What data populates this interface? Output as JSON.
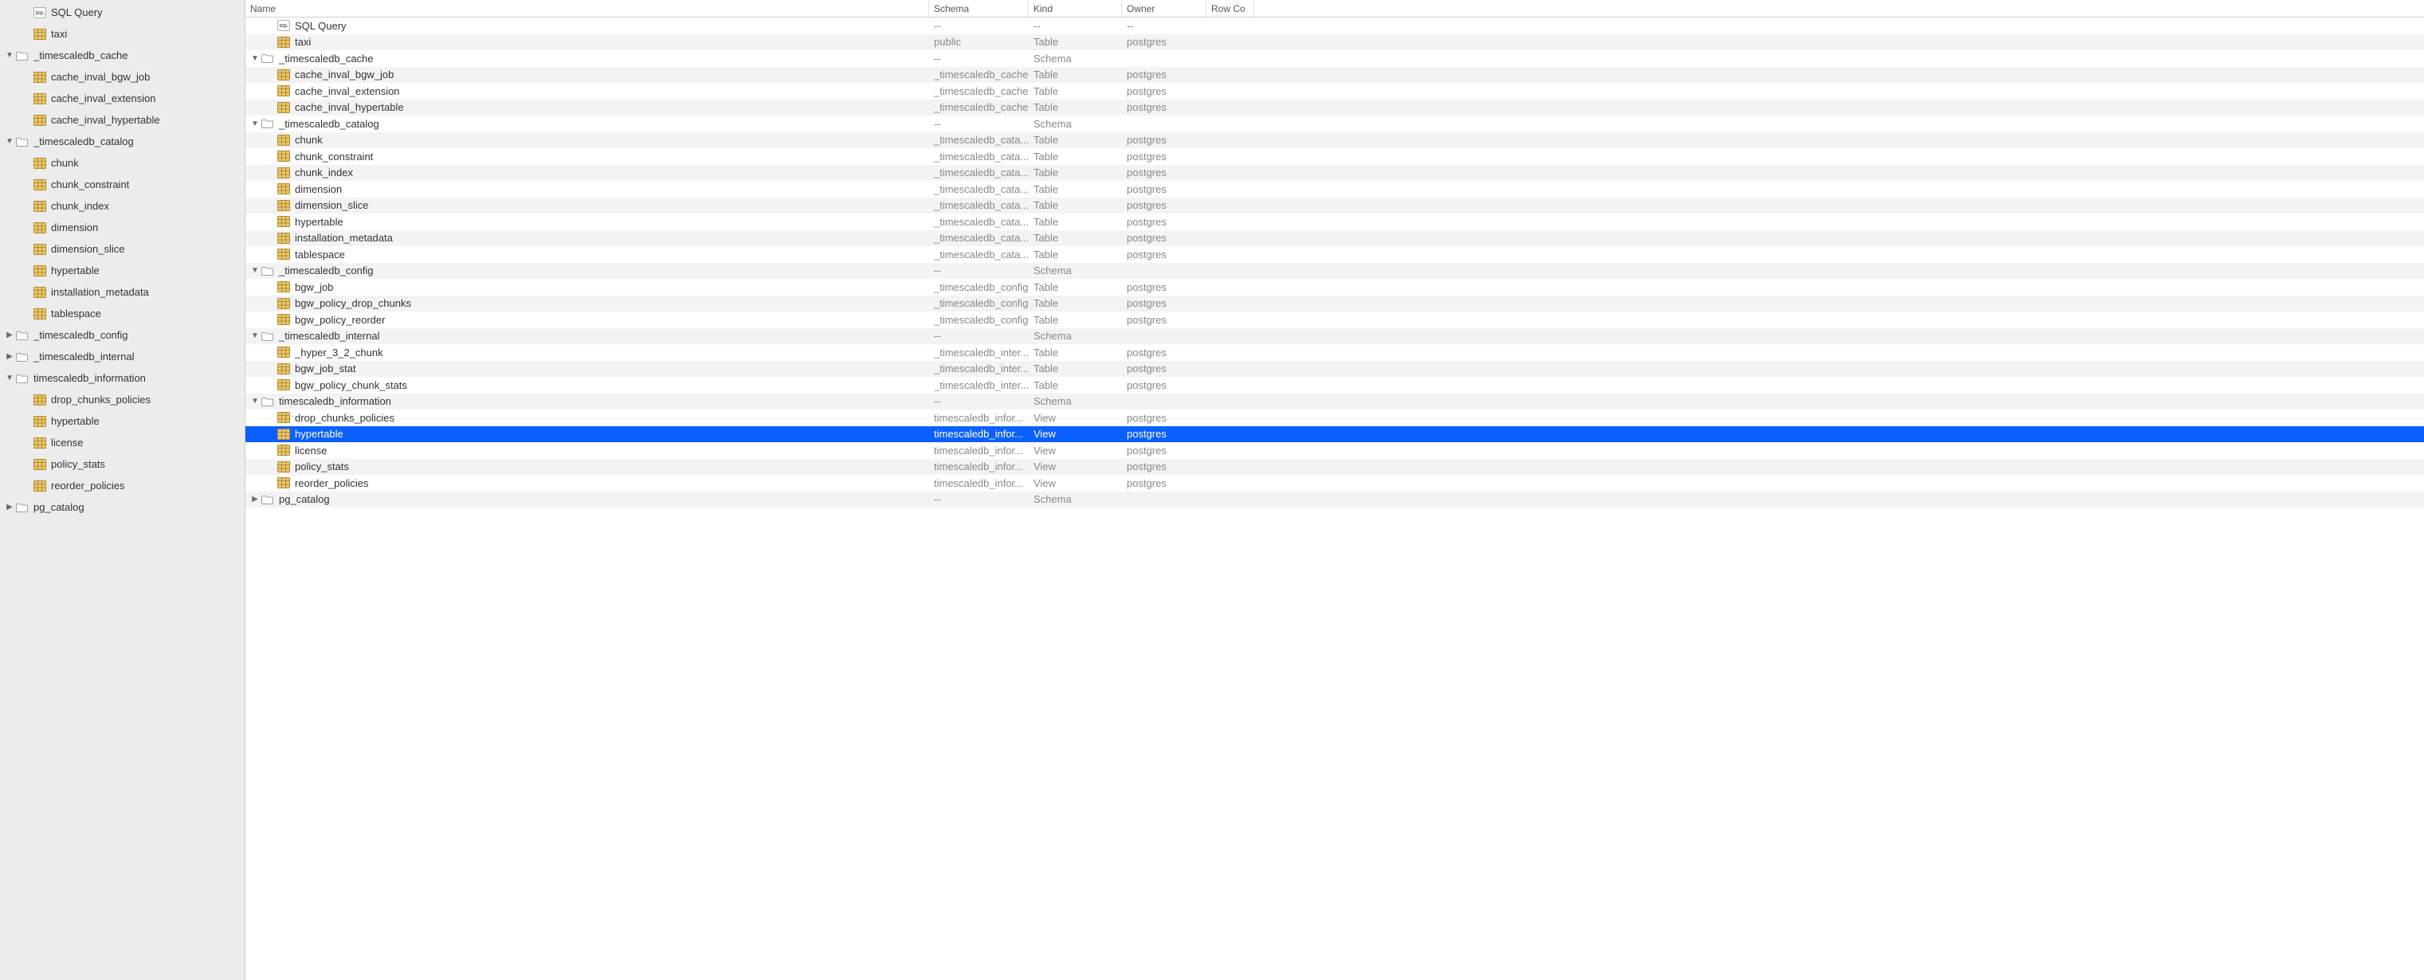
{
  "columns": {
    "name": "Name",
    "schema": "Schema",
    "kind": "Kind",
    "owner": "Owner",
    "rowcount": "Row Co"
  },
  "icons": {
    "sql": "sql-icon",
    "table": "table-icon",
    "view": "view-icon",
    "folder": "folder-icon"
  },
  "sidebar": [
    {
      "depth": 1,
      "icon": "sql",
      "label": "SQL Query",
      "disclosure": ""
    },
    {
      "depth": 1,
      "icon": "table",
      "label": "taxi",
      "disclosure": ""
    },
    {
      "depth": 0,
      "icon": "folder",
      "label": "_timescaledb_cache",
      "disclosure": "down"
    },
    {
      "depth": 1,
      "icon": "table",
      "label": "cache_inval_bgw_job",
      "disclosure": ""
    },
    {
      "depth": 1,
      "icon": "table",
      "label": "cache_inval_extension",
      "disclosure": ""
    },
    {
      "depth": 1,
      "icon": "table",
      "label": "cache_inval_hypertable",
      "disclosure": ""
    },
    {
      "depth": 0,
      "icon": "folder",
      "label": "_timescaledb_catalog",
      "disclosure": "down"
    },
    {
      "depth": 1,
      "icon": "table",
      "label": "chunk",
      "disclosure": ""
    },
    {
      "depth": 1,
      "icon": "table",
      "label": "chunk_constraint",
      "disclosure": ""
    },
    {
      "depth": 1,
      "icon": "table",
      "label": "chunk_index",
      "disclosure": ""
    },
    {
      "depth": 1,
      "icon": "table",
      "label": "dimension",
      "disclosure": ""
    },
    {
      "depth": 1,
      "icon": "table",
      "label": "dimension_slice",
      "disclosure": ""
    },
    {
      "depth": 1,
      "icon": "table",
      "label": "hypertable",
      "disclosure": ""
    },
    {
      "depth": 1,
      "icon": "table",
      "label": "installation_metadata",
      "disclosure": ""
    },
    {
      "depth": 1,
      "icon": "table",
      "label": "tablespace",
      "disclosure": ""
    },
    {
      "depth": 0,
      "icon": "folder",
      "label": "_timescaledb_config",
      "disclosure": "right"
    },
    {
      "depth": 0,
      "icon": "folder",
      "label": "_timescaledb_internal",
      "disclosure": "right"
    },
    {
      "depth": 0,
      "icon": "folder",
      "label": "timescaledb_information",
      "disclosure": "down"
    },
    {
      "depth": 1,
      "icon": "view",
      "label": "drop_chunks_policies",
      "disclosure": ""
    },
    {
      "depth": 1,
      "icon": "view",
      "label": "hypertable",
      "disclosure": ""
    },
    {
      "depth": 1,
      "icon": "view",
      "label": "license",
      "disclosure": ""
    },
    {
      "depth": 1,
      "icon": "view",
      "label": "policy_stats",
      "disclosure": ""
    },
    {
      "depth": 1,
      "icon": "view",
      "label": "reorder_policies",
      "disclosure": ""
    },
    {
      "depth": 0,
      "icon": "folder",
      "label": "pg_catalog",
      "disclosure": "right"
    }
  ],
  "rows": [
    {
      "depth": 1,
      "icon": "sql",
      "disclosure": "",
      "name": "SQL Query",
      "schema": "--",
      "kind": "--",
      "owner": "--"
    },
    {
      "depth": 1,
      "icon": "table",
      "disclosure": "",
      "name": "taxi",
      "schema": "public",
      "kind": "Table",
      "owner": "postgres"
    },
    {
      "depth": 0,
      "icon": "folder",
      "disclosure": "down",
      "name": "_timescaledb_cache",
      "schema": "--",
      "kind": "Schema",
      "owner": ""
    },
    {
      "depth": 1,
      "icon": "table",
      "disclosure": "",
      "name": "cache_inval_bgw_job",
      "schema": "_timescaledb_cache",
      "kind": "Table",
      "owner": "postgres"
    },
    {
      "depth": 1,
      "icon": "table",
      "disclosure": "",
      "name": "cache_inval_extension",
      "schema": "_timescaledb_cache",
      "kind": "Table",
      "owner": "postgres"
    },
    {
      "depth": 1,
      "icon": "table",
      "disclosure": "",
      "name": "cache_inval_hypertable",
      "schema": "_timescaledb_cache",
      "kind": "Table",
      "owner": "postgres"
    },
    {
      "depth": 0,
      "icon": "folder",
      "disclosure": "down",
      "name": "_timescaledb_catalog",
      "schema": "--",
      "kind": "Schema",
      "owner": ""
    },
    {
      "depth": 1,
      "icon": "table",
      "disclosure": "",
      "name": "chunk",
      "schema": "_timescaledb_cata...",
      "kind": "Table",
      "owner": "postgres"
    },
    {
      "depth": 1,
      "icon": "table",
      "disclosure": "",
      "name": "chunk_constraint",
      "schema": "_timescaledb_cata...",
      "kind": "Table",
      "owner": "postgres"
    },
    {
      "depth": 1,
      "icon": "table",
      "disclosure": "",
      "name": "chunk_index",
      "schema": "_timescaledb_cata...",
      "kind": "Table",
      "owner": "postgres"
    },
    {
      "depth": 1,
      "icon": "table",
      "disclosure": "",
      "name": "dimension",
      "schema": "_timescaledb_cata...",
      "kind": "Table",
      "owner": "postgres"
    },
    {
      "depth": 1,
      "icon": "table",
      "disclosure": "",
      "name": "dimension_slice",
      "schema": "_timescaledb_cata...",
      "kind": "Table",
      "owner": "postgres"
    },
    {
      "depth": 1,
      "icon": "table",
      "disclosure": "",
      "name": "hypertable",
      "schema": "_timescaledb_cata...",
      "kind": "Table",
      "owner": "postgres"
    },
    {
      "depth": 1,
      "icon": "table",
      "disclosure": "",
      "name": "installation_metadata",
      "schema": "_timescaledb_cata...",
      "kind": "Table",
      "owner": "postgres"
    },
    {
      "depth": 1,
      "icon": "table",
      "disclosure": "",
      "name": "tablespace",
      "schema": "_timescaledb_cata...",
      "kind": "Table",
      "owner": "postgres"
    },
    {
      "depth": 0,
      "icon": "folder",
      "disclosure": "down",
      "name": "_timescaledb_config",
      "schema": "--",
      "kind": "Schema",
      "owner": ""
    },
    {
      "depth": 1,
      "icon": "table",
      "disclosure": "",
      "name": "bgw_job",
      "schema": "_timescaledb_config",
      "kind": "Table",
      "owner": "postgres"
    },
    {
      "depth": 1,
      "icon": "table",
      "disclosure": "",
      "name": "bgw_policy_drop_chunks",
      "schema": "_timescaledb_config",
      "kind": "Table",
      "owner": "postgres"
    },
    {
      "depth": 1,
      "icon": "table",
      "disclosure": "",
      "name": "bgw_policy_reorder",
      "schema": "_timescaledb_config",
      "kind": "Table",
      "owner": "postgres"
    },
    {
      "depth": 0,
      "icon": "folder",
      "disclosure": "down",
      "name": "_timescaledb_internal",
      "schema": "--",
      "kind": "Schema",
      "owner": ""
    },
    {
      "depth": 1,
      "icon": "table",
      "disclosure": "",
      "name": "_hyper_3_2_chunk",
      "schema": "_timescaledb_inter...",
      "kind": "Table",
      "owner": "postgres"
    },
    {
      "depth": 1,
      "icon": "table",
      "disclosure": "",
      "name": "bgw_job_stat",
      "schema": "_timescaledb_inter...",
      "kind": "Table",
      "owner": "postgres"
    },
    {
      "depth": 1,
      "icon": "table",
      "disclosure": "",
      "name": "bgw_policy_chunk_stats",
      "schema": "_timescaledb_inter...",
      "kind": "Table",
      "owner": "postgres"
    },
    {
      "depth": 0,
      "icon": "folder",
      "disclosure": "down",
      "name": "timescaledb_information",
      "schema": "--",
      "kind": "Schema",
      "owner": ""
    },
    {
      "depth": 1,
      "icon": "view",
      "disclosure": "",
      "name": "drop_chunks_policies",
      "schema": "timescaledb_infor...",
      "kind": "View",
      "owner": "postgres"
    },
    {
      "depth": 1,
      "icon": "view",
      "disclosure": "",
      "name": "hypertable",
      "schema": "timescaledb_infor...",
      "kind": "View",
      "owner": "postgres",
      "selected": true
    },
    {
      "depth": 1,
      "icon": "view",
      "disclosure": "",
      "name": "license",
      "schema": "timescaledb_infor...",
      "kind": "View",
      "owner": "postgres"
    },
    {
      "depth": 1,
      "icon": "view",
      "disclosure": "",
      "name": "policy_stats",
      "schema": "timescaledb_infor...",
      "kind": "View",
      "owner": "postgres"
    },
    {
      "depth": 1,
      "icon": "view",
      "disclosure": "",
      "name": "reorder_policies",
      "schema": "timescaledb_infor...",
      "kind": "View",
      "owner": "postgres"
    },
    {
      "depth": 0,
      "icon": "folder",
      "disclosure": "right",
      "name": "pg_catalog",
      "schema": "--",
      "kind": "Schema",
      "owner": ""
    }
  ]
}
